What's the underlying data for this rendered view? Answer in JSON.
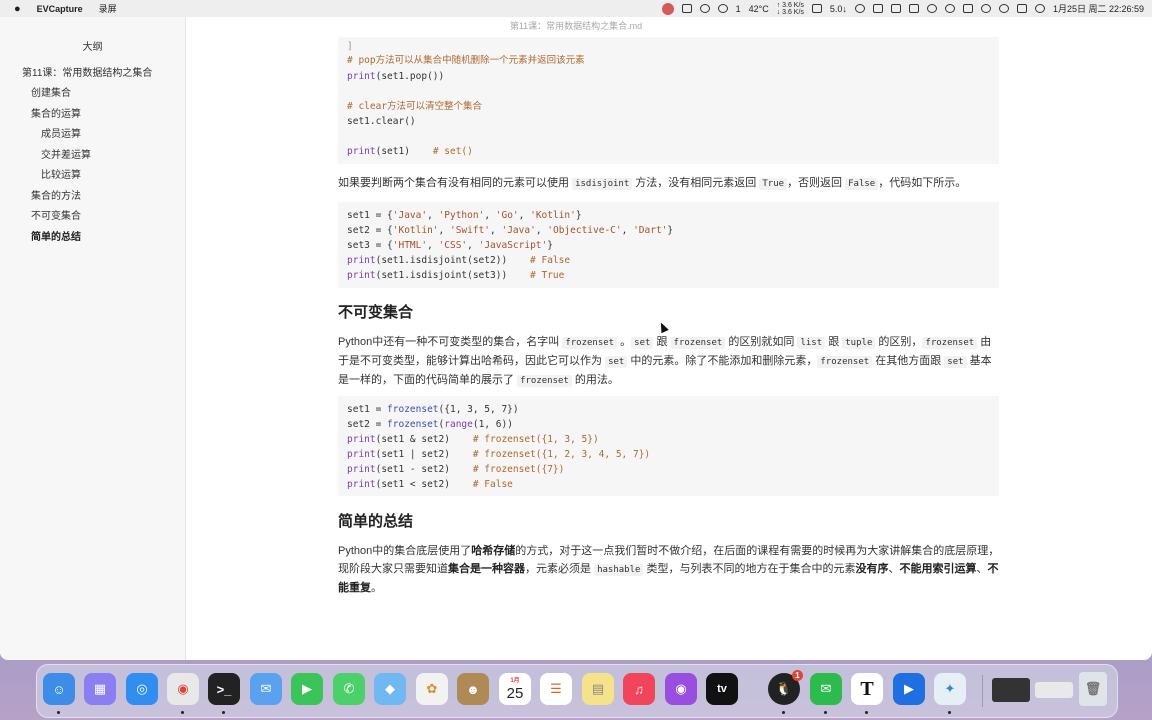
{
  "menubar": {
    "app_name": "EVCapture",
    "menu_record": "录屏",
    "temp": "42°C",
    "temp_sub": "SSD",
    "net_up": "↑ 3.6 K/s",
    "net_down": "↓ 3.6 K/s",
    "notif_count": "1",
    "speed": "5.0↓",
    "datetime": "1月25日 周二  22:26:59"
  },
  "window": {
    "title": "第11课：常用数据结构之集合.md"
  },
  "sidebar": {
    "title": "大纲",
    "items": [
      {
        "label": "第11课：常用数据结构之集合"
      },
      {
        "label": "创建集合"
      },
      {
        "label": "集合的运算"
      },
      {
        "label": "成员运算"
      },
      {
        "label": "交并差运算"
      },
      {
        "label": "比较运算"
      },
      {
        "label": "集合的方法"
      },
      {
        "label": "不可变集合"
      },
      {
        "label": "简单的总结"
      }
    ]
  },
  "content": {
    "code1": {
      "l0": "]",
      "l1": "# pop方法可以从集合中随机删除一个元素并返回该元素",
      "l2a": "print",
      "l2b": "(set1.pop())",
      "l3": "# clear方法可以清空整个集合",
      "l4": "set1.clear()",
      "l5a": "print",
      "l5b": "(set1)    ",
      "l5c": "# set()"
    },
    "para1": {
      "t1": "如果要判断两个集合有没有相同的元素可以使用 ",
      "c1": "isdisjoint",
      "t2": " 方法，没有相同元素返回 ",
      "c2": "True",
      "t3": "，否则返回 ",
      "c3": "False",
      "t4": "，代码如下所示。"
    },
    "code2": {
      "l1a": "set1 = {",
      "l1b": "'Java'",
      "l1c": ", ",
      "l1d": "'Python'",
      "l1e": ", ",
      "l1f": "'Go'",
      "l1g": ", ",
      "l1h": "'Kotlin'",
      "l1i": "}",
      "l2a": "set2 = {",
      "l2b": "'Kotlin'",
      "l2c": ", ",
      "l2d": "'Swift'",
      "l2e": ", ",
      "l2f": "'Java'",
      "l2g": ", ",
      "l2h": "'Objective-C'",
      "l2i": ", ",
      "l2j": "'Dart'",
      "l2k": "}",
      "l3a": "set3 = {",
      "l3b": "'HTML'",
      "l3c": ", ",
      "l3d": "'CSS'",
      "l3e": ", ",
      "l3f": "'JavaScript'",
      "l3g": "}",
      "l4a": "print",
      "l4b": "(set1.isdisjoint(set2))    ",
      "l4c": "# False",
      "l5a": "print",
      "l5b": "(set1.isdisjoint(set3))    ",
      "l5c": "# True"
    },
    "heading1": "不可变集合",
    "para2": {
      "t1": "Python中还有一种不可变类型的集合，名字叫 ",
      "c1": "frozenset",
      "t2": " 。",
      "c2": "set",
      "t3": " 跟 ",
      "c3": "frozenset",
      "t4": " 的区别就如同 ",
      "c4": "list",
      "t5": " 跟 ",
      "c5": "tuple",
      "t6": " 的区别，",
      "c6": "frozenset",
      "t7": " 由于是不可变类型，能够计算出哈希码，因此它可以作为 ",
      "c7": "set",
      "t8": " 中的元素。除了不能添加和删除元素，",
      "c8": "frozenset",
      "t9": " 在其他方面跟 ",
      "c9": "set",
      "t10": " 基本是一样的，下面的代码简单的展示了 ",
      "c10": "frozenset",
      "t11": " 的用法。"
    },
    "code3": {
      "l1a": "set1 = ",
      "l1b": "frozenset",
      "l1c": "({1, 3, 5, 7})",
      "l2a": "set2 = ",
      "l2b": "frozenset",
      "l2c": "(",
      "l2d": "range",
      "l2e": "(1, 6))",
      "l3a": "print",
      "l3b": "(set1 & set2)    ",
      "l3c": "# frozenset({1, 3, 5})",
      "l4a": "print",
      "l4b": "(set1 | set2)    ",
      "l4c": "# frozenset({1, 2, 3, 4, 5, 7})",
      "l5a": "print",
      "l5b": "(set1 - set2)    ",
      "l5c": "# frozenset({7})",
      "l6a": "print",
      "l6b": "(set1 < set2)    ",
      "l6c": "# False"
    },
    "heading2": "简单的总结",
    "para3": {
      "t1": "Python中的集合底层使用了",
      "b1": "哈希存储",
      "t2": "的方式，对于这一点我们暂时不做介绍，在后面的课程有需要的时候再为大家讲解集合的底层原理，现阶段大家只需要知道",
      "b2": "集合是一种容器",
      "t3": "，元素必须是 ",
      "c1": "hashable",
      "t4": " 类型，与列表不同的地方在于集合中的元素",
      "b3": "没有序",
      "t5": "、",
      "b4": "不能用索引运算",
      "t6": "、",
      "b5": "不能重复",
      "t7": "。"
    }
  },
  "dock": {
    "calendar_month": "1月",
    "calendar_day": "25",
    "qq_badge": "1",
    "typora_letter": "T",
    "tv_label": "tv"
  },
  "colors": {
    "code_bg": "#f6f6f6",
    "comment": "#b0672f",
    "string": "#a7512a",
    "builtin": "#7a3fb0"
  }
}
